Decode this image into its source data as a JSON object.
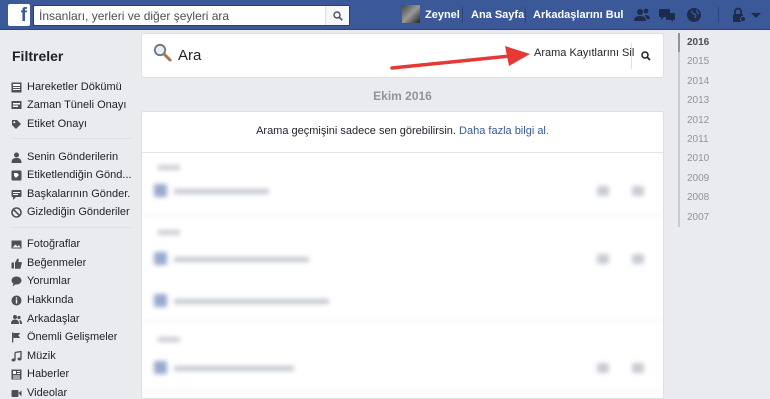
{
  "topbar": {
    "search_placeholder": "İnsanları, yerleri ve diğer şeyleri ara",
    "user_name": "Zeynel",
    "home": "Ana Sayfa",
    "find_friends": "Arkadaşlarını Bul",
    "logo": "f"
  },
  "sidebar": {
    "title": "Filtreler",
    "groups": [
      [
        {
          "label": "Hareketler Dökümü",
          "icon": "activity-log-icon"
        },
        {
          "label": "Zaman Tüneli Onayı",
          "icon": "timeline-review-icon"
        },
        {
          "label": "Etiket Onayı",
          "icon": "tag-icon"
        }
      ],
      [
        {
          "label": "Senin Gönderilerin",
          "icon": "person-icon"
        },
        {
          "label": "Etiketlendiğin Gönd...",
          "icon": "tagged-icon"
        },
        {
          "label": "Başkalarının Gönder...",
          "icon": "comments-icon"
        },
        {
          "label": "Gizlediğin Gönderiler",
          "icon": "hidden-icon"
        }
      ],
      [
        {
          "label": "Fotoğraflar",
          "icon": "photos-icon"
        },
        {
          "label": "Beğenmeler",
          "icon": "like-icon"
        },
        {
          "label": "Yorumlar",
          "icon": "comment-icon"
        },
        {
          "label": "Hakkında",
          "icon": "info-icon"
        },
        {
          "label": "Arkadaşlar",
          "icon": "friends-icon"
        },
        {
          "label": "Önemli Gelişmeler",
          "icon": "flag-icon"
        },
        {
          "label": "Müzik",
          "icon": "music-icon"
        },
        {
          "label": "Haberler",
          "icon": "news-icon"
        },
        {
          "label": "Videolar",
          "icon": "video-icon"
        }
      ]
    ]
  },
  "main": {
    "title": "Ara",
    "clear_button": "Arama Kayıtlarını Sil",
    "month": "Ekim 2016",
    "notice_text": "Arama geçmişini sadece sen görebilirsin. ",
    "notice_link": "Daha fazla bilgi al."
  },
  "years": [
    "2016",
    "2015",
    "2014",
    "2013",
    "2012",
    "2011",
    "2010",
    "2009",
    "2008",
    "2007"
  ],
  "colors": {
    "brand": "#3b5998",
    "background": "#e9ebee",
    "link": "#365899",
    "arrow": "#e53935"
  }
}
